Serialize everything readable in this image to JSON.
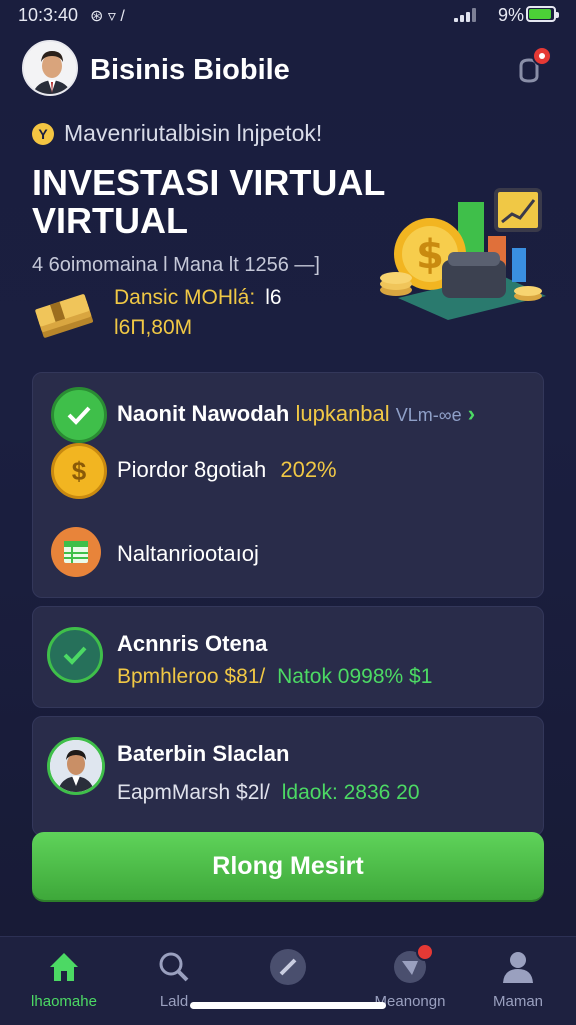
{
  "status_bar": {
    "time": "10:3:40",
    "left_icons": "⊛ ▿ /",
    "battery_pct": "9%"
  },
  "header": {
    "title": "Bisinis Biobile"
  },
  "hero": {
    "promo_text": "Mavenriutalbisin lnjpetok!",
    "promo_icon": "Y",
    "title": "INVESTASI VIRTUAL VIRTUAL",
    "subtitle": "4 6oimomaina l Mana lt 1256 —]",
    "balance_label": "Dansic MOHlá:",
    "balance_label_value": "l6",
    "balance_value": "l6П,80M"
  },
  "card1": {
    "row1": {
      "label": "Naonit Nawodah",
      "highlight": "lupkanbal",
      "extra": "VLm-∞e"
    },
    "row2": {
      "label": "Piordor 8gotiah",
      "value": "202%"
    },
    "row3": {
      "label": "Naltanriootaıoj"
    }
  },
  "card2": {
    "title": "Acnnris Otena",
    "detail1": "Bpmhleroo $81/",
    "detail2": "Natok 0998% $1"
  },
  "card3": {
    "title": "Baterbin Slaclan",
    "detail1": "EapmMarsh $2l/",
    "detail2": "ldaok: 2836 20"
  },
  "cta": {
    "label": "Rlong Mesirt"
  },
  "tabs": [
    {
      "label": "lhaomahe",
      "icon": "home-icon"
    },
    {
      "label": "Lald",
      "icon": "search-icon"
    },
    {
      "label": "",
      "icon": "compass-icon"
    },
    {
      "label": "Meanongn",
      "icon": "chat-icon"
    },
    {
      "label": "Maman",
      "icon": "profile-icon"
    }
  ],
  "colors": {
    "accent_green": "#4cd964",
    "accent_yellow": "#f0c845",
    "background": "#1b1f40",
    "card": "#292c4a"
  }
}
